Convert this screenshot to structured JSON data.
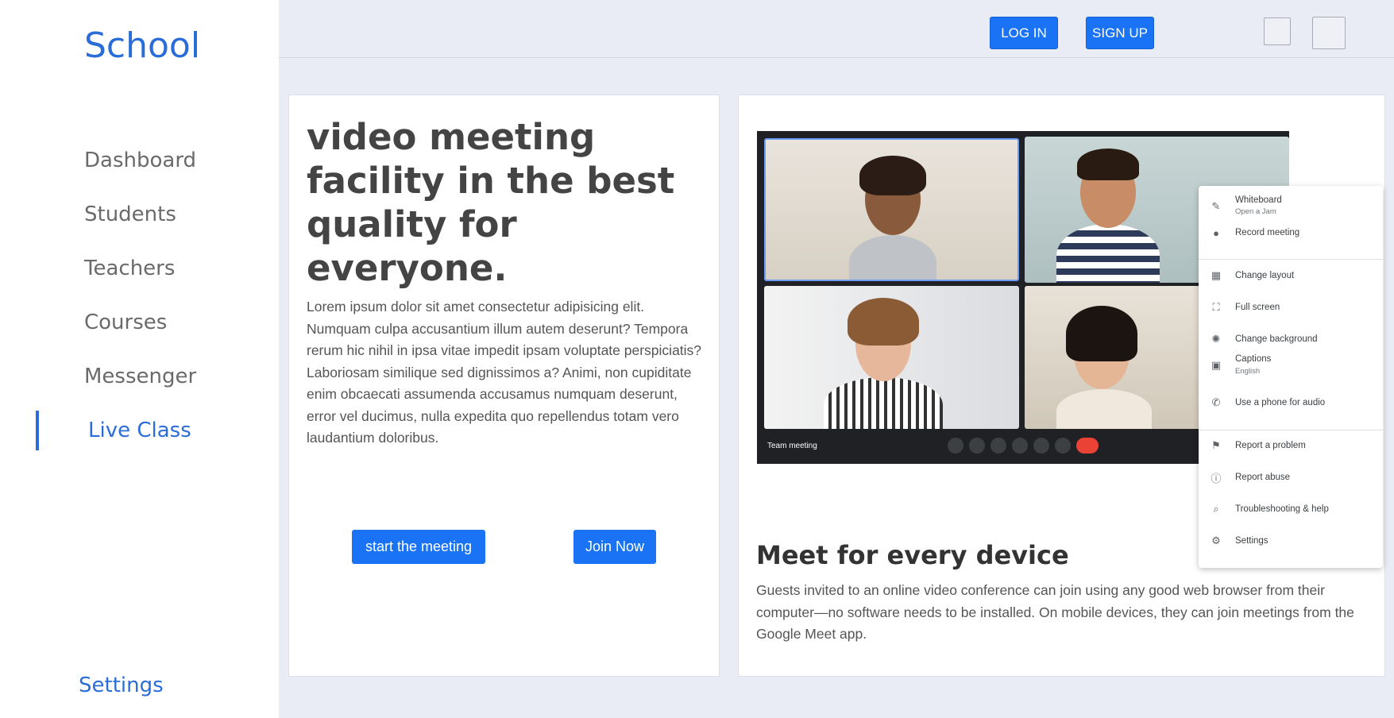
{
  "sidebar": {
    "brand": "School",
    "items": [
      {
        "label": "Dashboard"
      },
      {
        "label": "Students"
      },
      {
        "label": "Teachers"
      },
      {
        "label": "Courses"
      },
      {
        "label": "Messenger"
      },
      {
        "label": "Live Class"
      }
    ],
    "active_item": "Live Class",
    "settings_label": "Settings"
  },
  "header": {
    "login_label": "LOG IN",
    "signup_label": "SIGN UP"
  },
  "left_card": {
    "headline": "video meeting facility in the best quality for everyone.",
    "body": "Lorem ipsum dolor sit amet consectetur adipisicing elit. Numquam culpa accusantium illum autem deserunt? Tempora rerum hic nihil in ipsa vitae impedit ipsam voluptate perspiciatis? Laboriosam similique sed dignissimos a? Animi, non cupiditate enim obcaecati assumenda accusamus numquam deserunt, error vel ducimus, nulla expedita quo repellendus totam vero laudantium doloribus.",
    "start_button": "start the meeting",
    "join_button": "Join Now"
  },
  "right_card": {
    "title": "Meet for every device",
    "description": "Guests invited to an online video conference can join using any good web browser from their computer—no software needs to be installed. On mobile devices, they can join meetings from the Google Meet app.",
    "video": {
      "meeting_label": "Team meeting",
      "menu": [
        {
          "label": "Whiteboard",
          "sub": "Open a Jam",
          "icon": "pencil-icon"
        },
        {
          "label": "Record meeting",
          "icon": "record-icon"
        },
        {
          "label": "Change layout",
          "icon": "layout-icon"
        },
        {
          "label": "Full screen",
          "icon": "fullscreen-icon"
        },
        {
          "label": "Change background",
          "icon": "background-icon"
        },
        {
          "label": "Captions",
          "sub": "English",
          "icon": "captions-icon"
        },
        {
          "label": "Use a phone for audio",
          "icon": "phone-icon"
        },
        {
          "label": "Report a problem",
          "icon": "report-problem-icon"
        },
        {
          "label": "Report abuse",
          "icon": "report-abuse-icon"
        },
        {
          "label": "Troubleshooting & help",
          "icon": "troubleshoot-icon"
        },
        {
          "label": "Settings",
          "icon": "gear-icon"
        }
      ]
    }
  },
  "colors": {
    "accent": "#2a6dd9",
    "button": "#1a73f5",
    "background": "#e9ebf5"
  }
}
